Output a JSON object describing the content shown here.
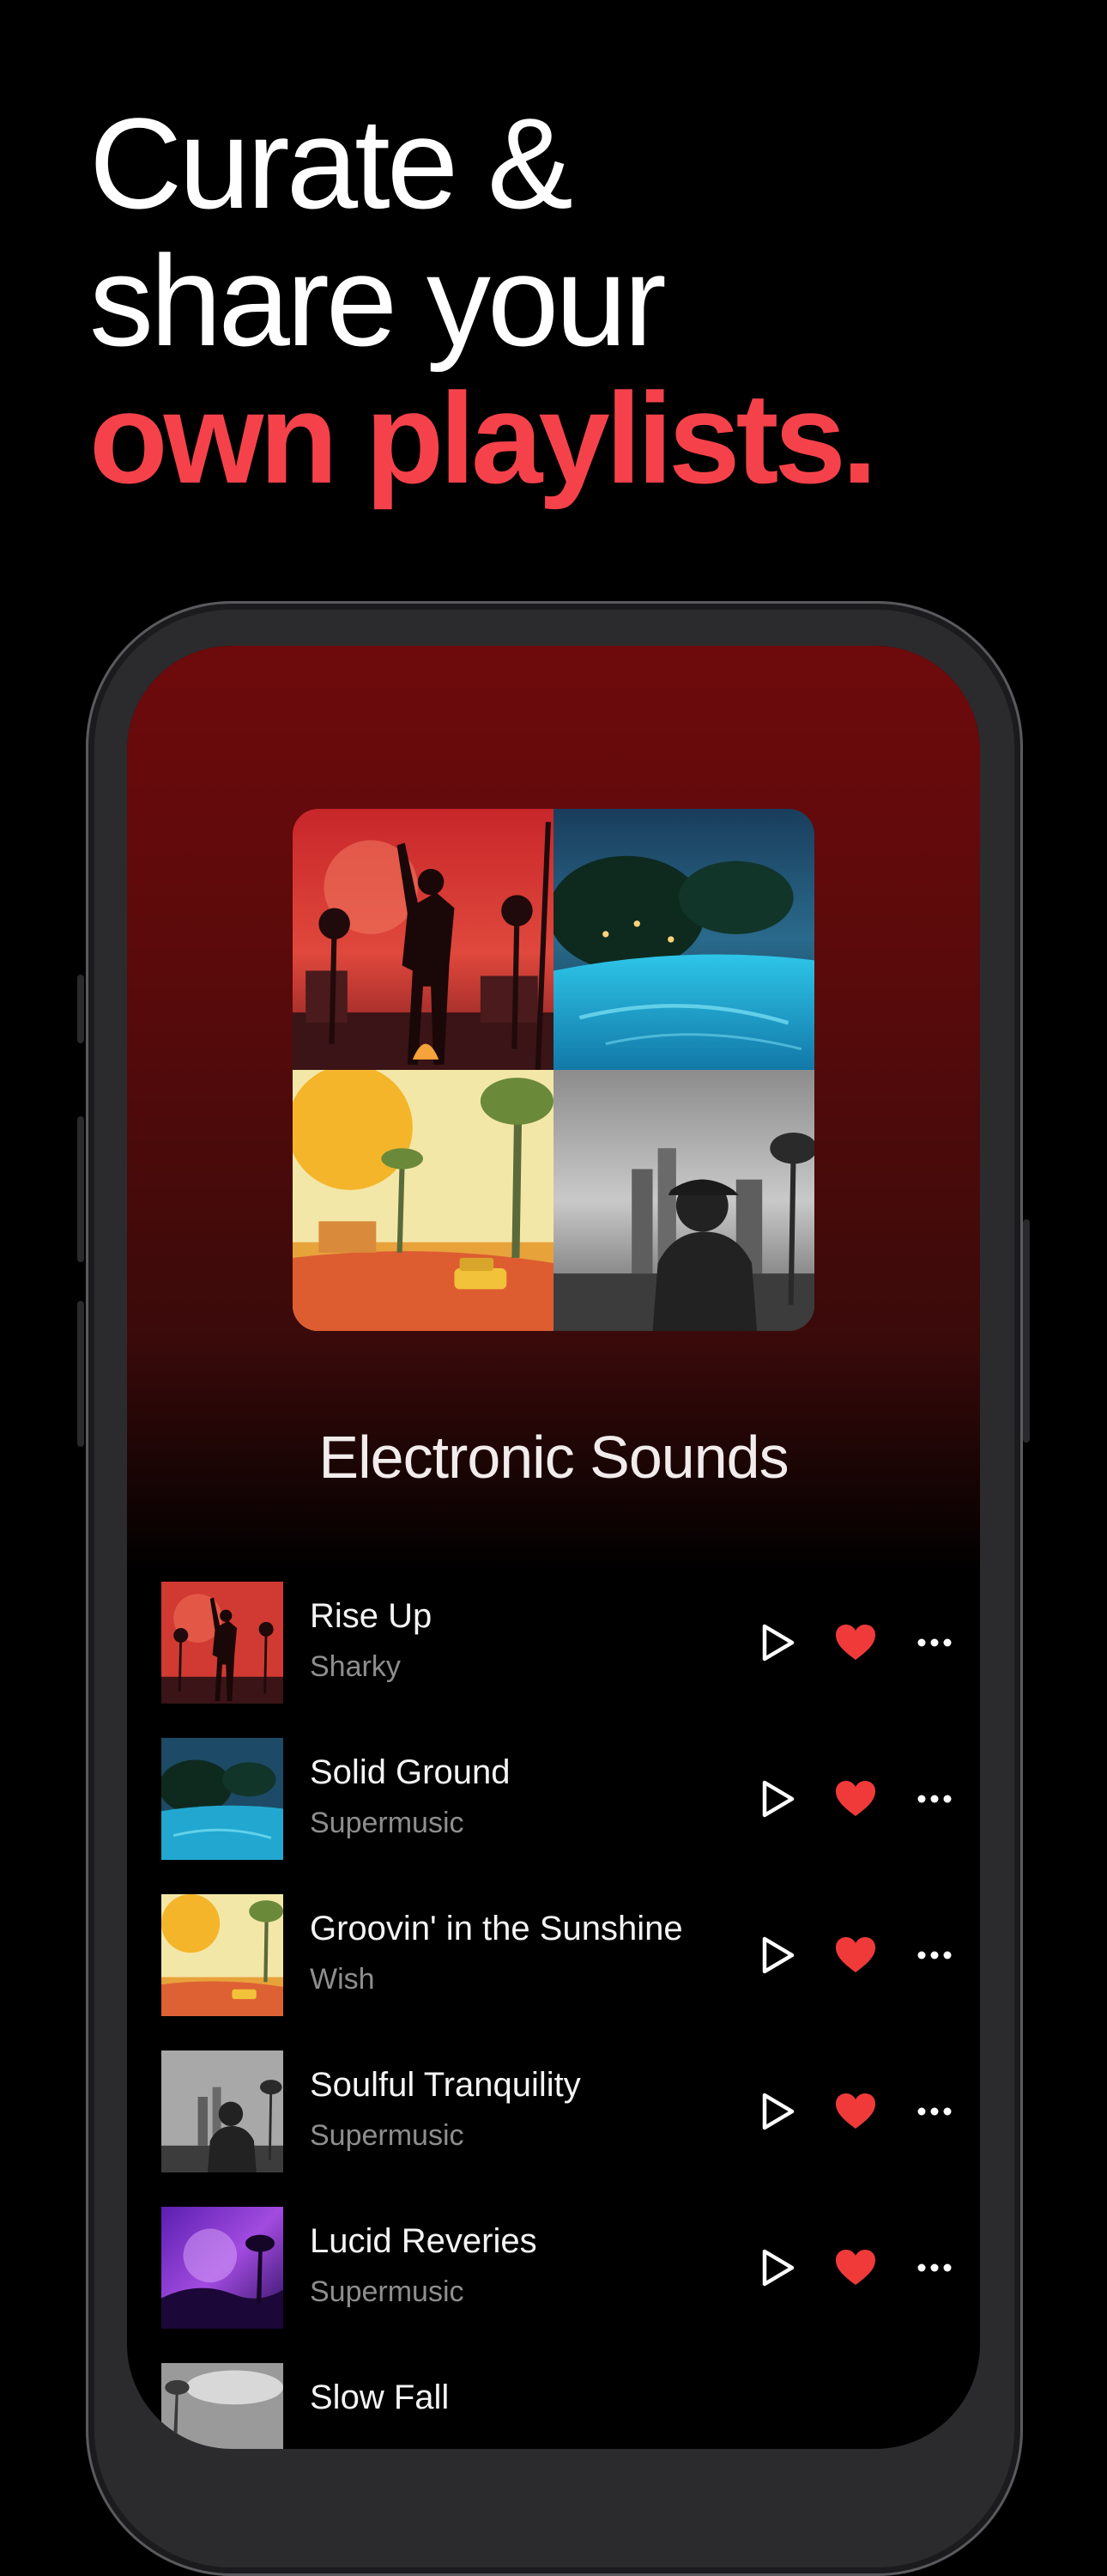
{
  "headline": {
    "line1": "Curate &",
    "line2": "share your",
    "line3": "own playlists."
  },
  "playlist": {
    "title": "Electronic Sounds"
  },
  "colors": {
    "accent": "#f5424a",
    "heart": "#f03a3a",
    "gradient_top": "#6e0a0c"
  },
  "icons": {
    "play": "play-icon",
    "like": "heart-icon",
    "more": "ellipsis-icon"
  },
  "tracks": [
    {
      "title": "Rise Up",
      "artist": "Sharky"
    },
    {
      "title": "Solid Ground",
      "artist": "Supermusic"
    },
    {
      "title": "Groovin' in the Sunshine",
      "artist": "Wish"
    },
    {
      "title": "Soulful Tranquility",
      "artist": "Supermusic"
    },
    {
      "title": "Lucid Reveries",
      "artist": "Supermusic"
    },
    {
      "title": "Slow Fall",
      "artist": ""
    }
  ]
}
